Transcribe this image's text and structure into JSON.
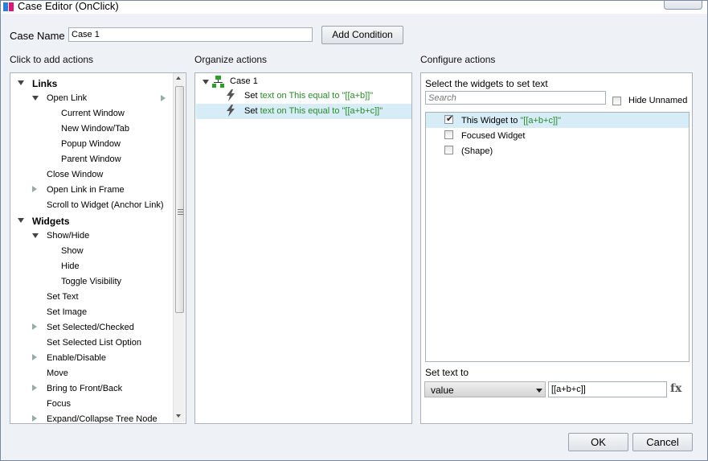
{
  "window": {
    "title": "Case Editor (OnClick)"
  },
  "case_name": {
    "label": "Case Name",
    "value": "Case 1"
  },
  "add_condition": "Add Condition",
  "left_panel": {
    "header": "Click to add actions",
    "items": [
      {
        "label": "Links",
        "level": 0,
        "expander": "down"
      },
      {
        "label": "Open Link",
        "level": 1,
        "expander": "down"
      },
      {
        "label": "Current Window",
        "level": 2
      },
      {
        "label": "New Window/Tab",
        "level": 2
      },
      {
        "label": "Popup Window",
        "level": 2
      },
      {
        "label": "Parent Window",
        "level": 2
      },
      {
        "label": "Close Window",
        "level": 1
      },
      {
        "label": "Open Link in Frame",
        "level": 1,
        "expander": "right"
      },
      {
        "label": "Scroll to Widget (Anchor Link)",
        "level": 1
      },
      {
        "label": "Widgets",
        "level": 0,
        "expander": "down"
      },
      {
        "label": "Show/Hide",
        "level": 1,
        "expander": "down"
      },
      {
        "label": "Show",
        "level": 2
      },
      {
        "label": "Hide",
        "level": 2
      },
      {
        "label": "Toggle Visibility",
        "level": 2
      },
      {
        "label": "Set Text",
        "level": 1
      },
      {
        "label": "Set Image",
        "level": 1
      },
      {
        "label": "Set Selected/Checked",
        "level": 1,
        "expander": "right"
      },
      {
        "label": "Set Selected List Option",
        "level": 1
      },
      {
        "label": "Enable/Disable",
        "level": 1,
        "expander": "right"
      },
      {
        "label": "Move",
        "level": 1
      },
      {
        "label": "Bring to Front/Back",
        "level": 1,
        "expander": "right"
      },
      {
        "label": "Focus",
        "level": 1
      },
      {
        "label": "Expand/Collapse Tree Node",
        "level": 1,
        "expander": "right"
      }
    ]
  },
  "middle_panel": {
    "header": "Organize actions",
    "case_label": "Case 1",
    "actions": [
      {
        "prefix": "Set",
        "detail": "text on This equal to \"[[a+b]]\"",
        "selected": false
      },
      {
        "prefix": "Set",
        "detail": "text on This equal to \"[[a+b+c]]\"",
        "selected": true
      }
    ]
  },
  "right_panel": {
    "header": "Configure actions",
    "subheader": "Select the widgets to set text",
    "search_placeholder": "Search",
    "hide_unnamed": "Hide Unnamed",
    "widgets": [
      {
        "name": "This Widget",
        "to": " to ",
        "value": "\"[[a+b+c]]\"",
        "checked": true
      },
      {
        "name": "Focused Widget",
        "to": "",
        "value": "",
        "checked": false
      },
      {
        "name": "(Shape)",
        "to": "",
        "value": "",
        "checked": false
      }
    ],
    "set_text_to": "Set text to",
    "mode": "value",
    "text_value": "[[a+b+c]]",
    "fx": "fx"
  },
  "footer": {
    "ok": "OK",
    "cancel": "Cancel"
  }
}
